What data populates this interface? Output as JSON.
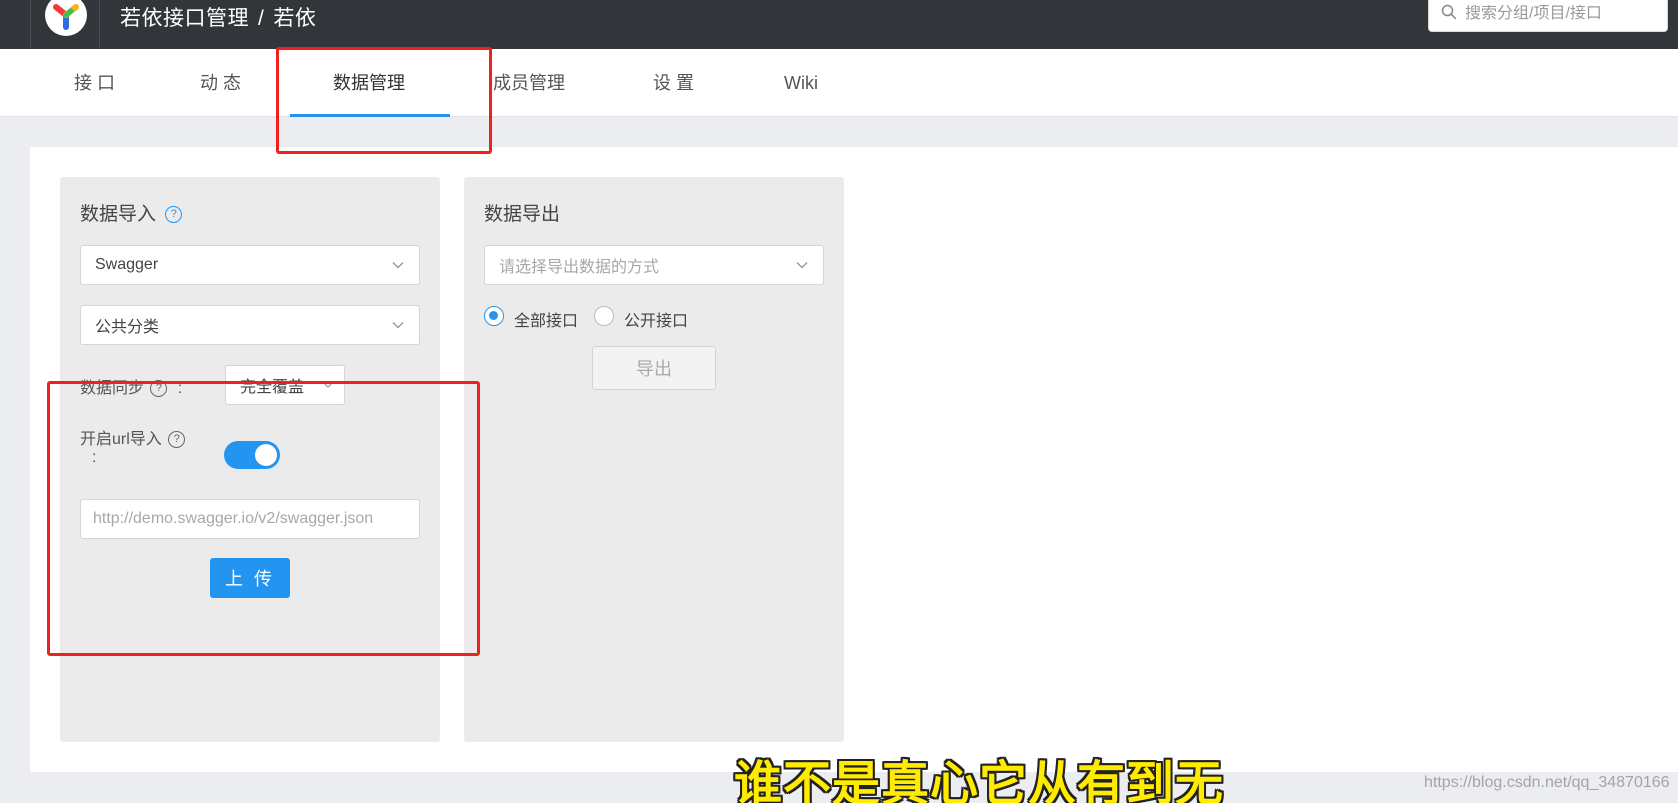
{
  "header": {
    "breadcrumb": {
      "group": "若依接口管理",
      "separator": "/",
      "project": "若依"
    },
    "search": {
      "placeholder": "搜索分组/项目/接口"
    }
  },
  "tabs": [
    {
      "label": "接 口"
    },
    {
      "label": "动 态"
    },
    {
      "label": "数据管理",
      "active": true
    },
    {
      "label": "成员管理"
    },
    {
      "label": "设 置"
    },
    {
      "label": "Wiki"
    }
  ],
  "import_panel": {
    "title": "数据导入",
    "format_select": {
      "value": "Swagger"
    },
    "category_select": {
      "value": "公共分类"
    },
    "sync_label": "数据同步",
    "sync_colon": ":",
    "sync_select": {
      "value": "完全覆盖"
    },
    "url_import_label": "开启url导入",
    "url_import_colon": ":",
    "url_import_enabled": true,
    "url_input": {
      "value": "",
      "placeholder": "http://demo.swagger.io/v2/swagger.json"
    },
    "upload_button": "上 传"
  },
  "export_panel": {
    "title": "数据导出",
    "method_select": {
      "placeholder": "请选择导出数据的方式"
    },
    "radio_all": {
      "label": "全部接口",
      "checked": true
    },
    "radio_public": {
      "label": "公开接口",
      "checked": false
    },
    "export_button": "导出"
  },
  "overlay": {
    "subtitle": "谁不是真心它从有到无",
    "watermark": "https://blog.csdn.net/qq_34870166"
  },
  "colors": {
    "accent": "#2395f1",
    "header_bg": "#32363a",
    "annotation": "#f02020",
    "subtitle": "#ffeb00"
  },
  "icons": [
    "logo-icon",
    "search-icon",
    "chevron-down-icon",
    "question-icon"
  ]
}
